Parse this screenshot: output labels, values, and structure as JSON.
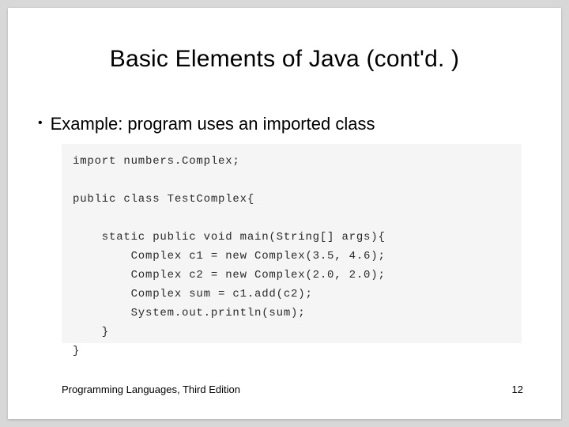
{
  "slide": {
    "title": "Basic Elements of Java (cont'd. )",
    "bullet": "Example: program uses an imported class",
    "code": "import numbers.Complex;\n\npublic class TestComplex{\n\n    static public void main(String[] args){\n        Complex c1 = new Complex(3.5, 4.6);\n        Complex c2 = new Complex(2.0, 2.0);\n        Complex sum = c1.add(c2);\n        System.out.println(sum);\n    }\n}",
    "footer_left": "Programming Languages, Third Edition",
    "page_number": "12"
  }
}
